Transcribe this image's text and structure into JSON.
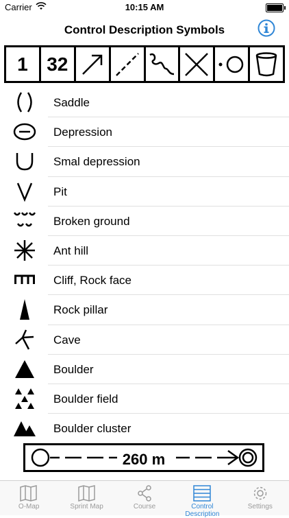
{
  "status": {
    "carrier": "Carrier",
    "time": "10:15 AM"
  },
  "nav": {
    "title": "Control Description Symbols"
  },
  "strip": {
    "col1": "1",
    "col2": "32"
  },
  "list": {
    "items": [
      {
        "label": "Saddle",
        "icon": "saddle-icon"
      },
      {
        "label": "Depression",
        "icon": "depression-icon"
      },
      {
        "label": "Smal depression",
        "icon": "small-depression-icon"
      },
      {
        "label": "Pit",
        "icon": "pit-icon"
      },
      {
        "label": "Broken ground",
        "icon": "broken-ground-icon"
      },
      {
        "label": "Ant hill",
        "icon": "ant-hill-icon"
      },
      {
        "label": "Cliff, Rock face",
        "icon": "cliff-icon"
      },
      {
        "label": "Rock pillar",
        "icon": "rock-pillar-icon"
      },
      {
        "label": "Cave",
        "icon": "cave-icon"
      },
      {
        "label": "Boulder",
        "icon": "boulder-icon"
      },
      {
        "label": "Boulder field",
        "icon": "boulder-field-icon"
      },
      {
        "label": "Boulder cluster",
        "icon": "boulder-cluster-icon"
      }
    ]
  },
  "distance": {
    "text": "260 m"
  },
  "tabs": [
    {
      "label": "O-Map"
    },
    {
      "label": "Sprint Map"
    },
    {
      "label": "Course"
    },
    {
      "label": "Control Description"
    },
    {
      "label": "Settings"
    }
  ],
  "colors": {
    "accent": "#2f86d6",
    "inactive": "#9a9a9a"
  }
}
